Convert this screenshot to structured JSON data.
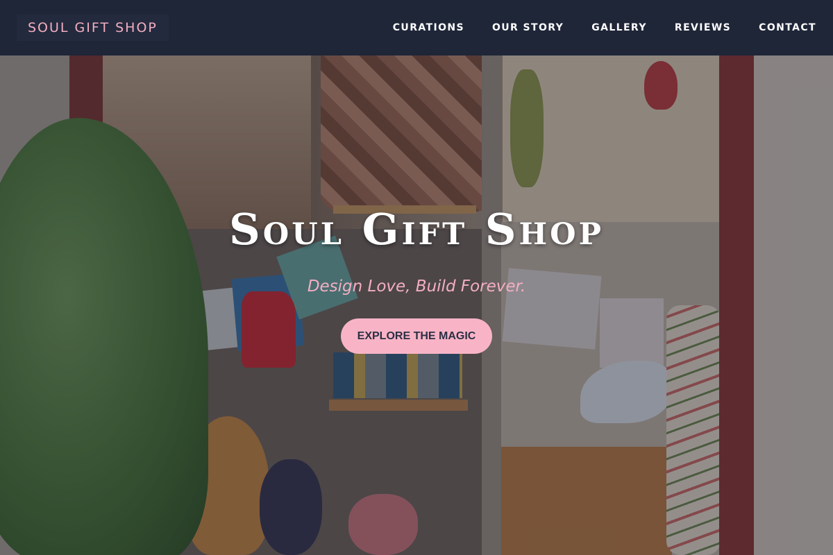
{
  "header": {
    "brand": "SOUL GIFT SHOP",
    "nav": [
      {
        "label": "CURATIONS"
      },
      {
        "label": "OUR STORY"
      },
      {
        "label": "GALLERY"
      },
      {
        "label": "REVIEWS"
      },
      {
        "label": "CONTACT"
      }
    ]
  },
  "hero": {
    "title": "Soul Gift Shop",
    "tagline": "Design Love, Build Forever.",
    "cta_label": "EXPLORE THE MAGIC"
  },
  "colors": {
    "navbar_bg": "#1f2638",
    "brand_accent": "#f4aec2",
    "cta_bg": "#f8b4c6",
    "cta_text": "#2b2f45"
  }
}
